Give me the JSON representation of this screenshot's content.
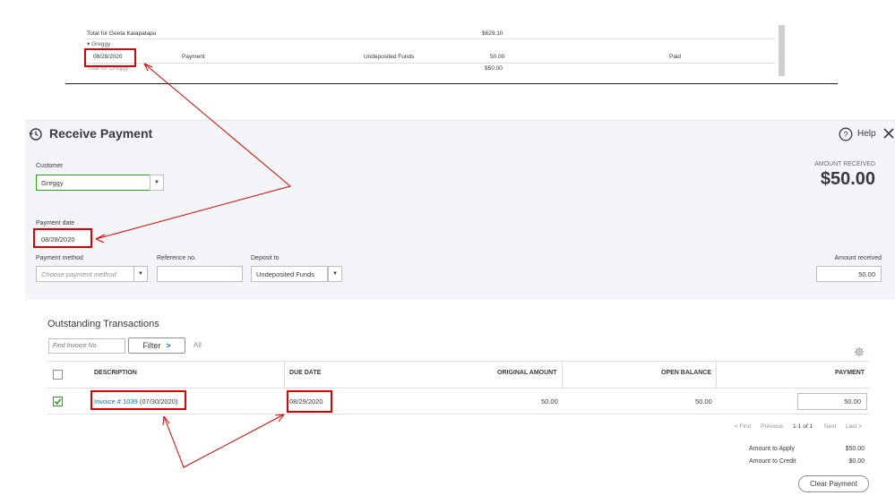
{
  "report": {
    "total_geeta_label": "Total for Geeta Kalapatapu",
    "total_geeta_amount": "$629.10",
    "group_label": "▾ Greggy",
    "row": {
      "date": "08/28/2020",
      "type": "Payment",
      "account": "Undeposited Funds",
      "amount": "50.00",
      "status": "Paid"
    },
    "total_greggy_label": "Total for Greggy",
    "total_greggy_amount": "$50.00"
  },
  "header": {
    "title": "Receive Payment",
    "help_label": "Help",
    "amount_received_label": "AMOUNT RECEIVED",
    "amount_received_value": "$50.00"
  },
  "form": {
    "customer_label": "Customer",
    "customer_value": "Greggy",
    "payment_date_label": "Payment date",
    "payment_date_value": "08/28/2020",
    "payment_method_label": "Payment method",
    "payment_method_placeholder": "Choose payment method",
    "reference_label": "Reference no.",
    "reference_value": "",
    "deposit_to_label": "Deposit to",
    "deposit_to_value": "Undeposited Funds",
    "amount_received_label": "Amount received",
    "amount_received_value": "50.00"
  },
  "outstanding": {
    "title": "Outstanding Transactions",
    "find_placeholder": "Find Invoice No.",
    "filter_label": "Filter",
    "all_label": "All",
    "columns": {
      "description": "DESCRIPTION",
      "due_date": "DUE DATE",
      "original_amount": "ORIGINAL AMOUNT",
      "open_balance": "OPEN BALANCE",
      "payment": "PAYMENT"
    },
    "rows": [
      {
        "invoice_link": "Invoice # 1039",
        "invoice_date": " (07/30/2020)",
        "due_date": "08/29/2020",
        "original_amount": "50.00",
        "open_balance": "50.00",
        "payment": "50.00",
        "checked": true
      }
    ],
    "pager": {
      "first": "< First",
      "previous": "Previous",
      "range": "1-1 of 1",
      "next": "Next",
      "last": "Last >"
    },
    "amount_to_apply_label": "Amount to Apply",
    "amount_to_apply_value": "$50.00",
    "amount_to_credit_label": "Amount to Credit",
    "amount_to_credit_value": "$0.00",
    "clear_payment_label": "Clear Payment"
  },
  "colors": {
    "annotation_red": "#e00000",
    "link_blue": "#0077c5",
    "check_green": "#2ca01c"
  }
}
